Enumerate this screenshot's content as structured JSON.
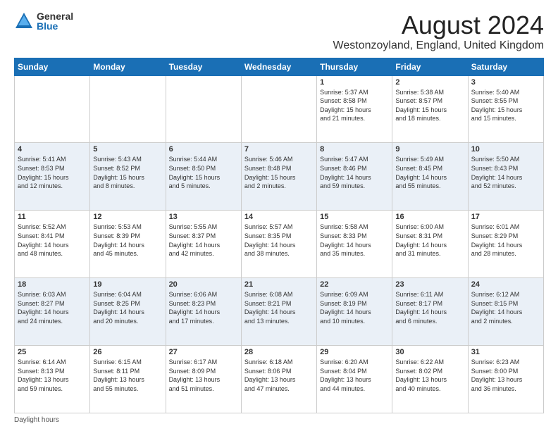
{
  "header": {
    "logo_general": "General",
    "logo_blue": "Blue",
    "month_title": "August 2024",
    "location": "Westonzoyland, England, United Kingdom"
  },
  "days_of_week": [
    "Sunday",
    "Monday",
    "Tuesday",
    "Wednesday",
    "Thursday",
    "Friday",
    "Saturday"
  ],
  "footer_note": "Daylight hours",
  "weeks": [
    [
      {
        "day": "",
        "info": ""
      },
      {
        "day": "",
        "info": ""
      },
      {
        "day": "",
        "info": ""
      },
      {
        "day": "",
        "info": ""
      },
      {
        "day": "1",
        "info": "Sunrise: 5:37 AM\nSunset: 8:58 PM\nDaylight: 15 hours\nand 21 minutes."
      },
      {
        "day": "2",
        "info": "Sunrise: 5:38 AM\nSunset: 8:57 PM\nDaylight: 15 hours\nand 18 minutes."
      },
      {
        "day": "3",
        "info": "Sunrise: 5:40 AM\nSunset: 8:55 PM\nDaylight: 15 hours\nand 15 minutes."
      }
    ],
    [
      {
        "day": "4",
        "info": "Sunrise: 5:41 AM\nSunset: 8:53 PM\nDaylight: 15 hours\nand 12 minutes."
      },
      {
        "day": "5",
        "info": "Sunrise: 5:43 AM\nSunset: 8:52 PM\nDaylight: 15 hours\nand 8 minutes."
      },
      {
        "day": "6",
        "info": "Sunrise: 5:44 AM\nSunset: 8:50 PM\nDaylight: 15 hours\nand 5 minutes."
      },
      {
        "day": "7",
        "info": "Sunrise: 5:46 AM\nSunset: 8:48 PM\nDaylight: 15 hours\nand 2 minutes."
      },
      {
        "day": "8",
        "info": "Sunrise: 5:47 AM\nSunset: 8:46 PM\nDaylight: 14 hours\nand 59 minutes."
      },
      {
        "day": "9",
        "info": "Sunrise: 5:49 AM\nSunset: 8:45 PM\nDaylight: 14 hours\nand 55 minutes."
      },
      {
        "day": "10",
        "info": "Sunrise: 5:50 AM\nSunset: 8:43 PM\nDaylight: 14 hours\nand 52 minutes."
      }
    ],
    [
      {
        "day": "11",
        "info": "Sunrise: 5:52 AM\nSunset: 8:41 PM\nDaylight: 14 hours\nand 48 minutes."
      },
      {
        "day": "12",
        "info": "Sunrise: 5:53 AM\nSunset: 8:39 PM\nDaylight: 14 hours\nand 45 minutes."
      },
      {
        "day": "13",
        "info": "Sunrise: 5:55 AM\nSunset: 8:37 PM\nDaylight: 14 hours\nand 42 minutes."
      },
      {
        "day": "14",
        "info": "Sunrise: 5:57 AM\nSunset: 8:35 PM\nDaylight: 14 hours\nand 38 minutes."
      },
      {
        "day": "15",
        "info": "Sunrise: 5:58 AM\nSunset: 8:33 PM\nDaylight: 14 hours\nand 35 minutes."
      },
      {
        "day": "16",
        "info": "Sunrise: 6:00 AM\nSunset: 8:31 PM\nDaylight: 14 hours\nand 31 minutes."
      },
      {
        "day": "17",
        "info": "Sunrise: 6:01 AM\nSunset: 8:29 PM\nDaylight: 14 hours\nand 28 minutes."
      }
    ],
    [
      {
        "day": "18",
        "info": "Sunrise: 6:03 AM\nSunset: 8:27 PM\nDaylight: 14 hours\nand 24 minutes."
      },
      {
        "day": "19",
        "info": "Sunrise: 6:04 AM\nSunset: 8:25 PM\nDaylight: 14 hours\nand 20 minutes."
      },
      {
        "day": "20",
        "info": "Sunrise: 6:06 AM\nSunset: 8:23 PM\nDaylight: 14 hours\nand 17 minutes."
      },
      {
        "day": "21",
        "info": "Sunrise: 6:08 AM\nSunset: 8:21 PM\nDaylight: 14 hours\nand 13 minutes."
      },
      {
        "day": "22",
        "info": "Sunrise: 6:09 AM\nSunset: 8:19 PM\nDaylight: 14 hours\nand 10 minutes."
      },
      {
        "day": "23",
        "info": "Sunrise: 6:11 AM\nSunset: 8:17 PM\nDaylight: 14 hours\nand 6 minutes."
      },
      {
        "day": "24",
        "info": "Sunrise: 6:12 AM\nSunset: 8:15 PM\nDaylight: 14 hours\nand 2 minutes."
      }
    ],
    [
      {
        "day": "25",
        "info": "Sunrise: 6:14 AM\nSunset: 8:13 PM\nDaylight: 13 hours\nand 59 minutes."
      },
      {
        "day": "26",
        "info": "Sunrise: 6:15 AM\nSunset: 8:11 PM\nDaylight: 13 hours\nand 55 minutes."
      },
      {
        "day": "27",
        "info": "Sunrise: 6:17 AM\nSunset: 8:09 PM\nDaylight: 13 hours\nand 51 minutes."
      },
      {
        "day": "28",
        "info": "Sunrise: 6:18 AM\nSunset: 8:06 PM\nDaylight: 13 hours\nand 47 minutes."
      },
      {
        "day": "29",
        "info": "Sunrise: 6:20 AM\nSunset: 8:04 PM\nDaylight: 13 hours\nand 44 minutes."
      },
      {
        "day": "30",
        "info": "Sunrise: 6:22 AM\nSunset: 8:02 PM\nDaylight: 13 hours\nand 40 minutes."
      },
      {
        "day": "31",
        "info": "Sunrise: 6:23 AM\nSunset: 8:00 PM\nDaylight: 13 hours\nand 36 minutes."
      }
    ]
  ]
}
